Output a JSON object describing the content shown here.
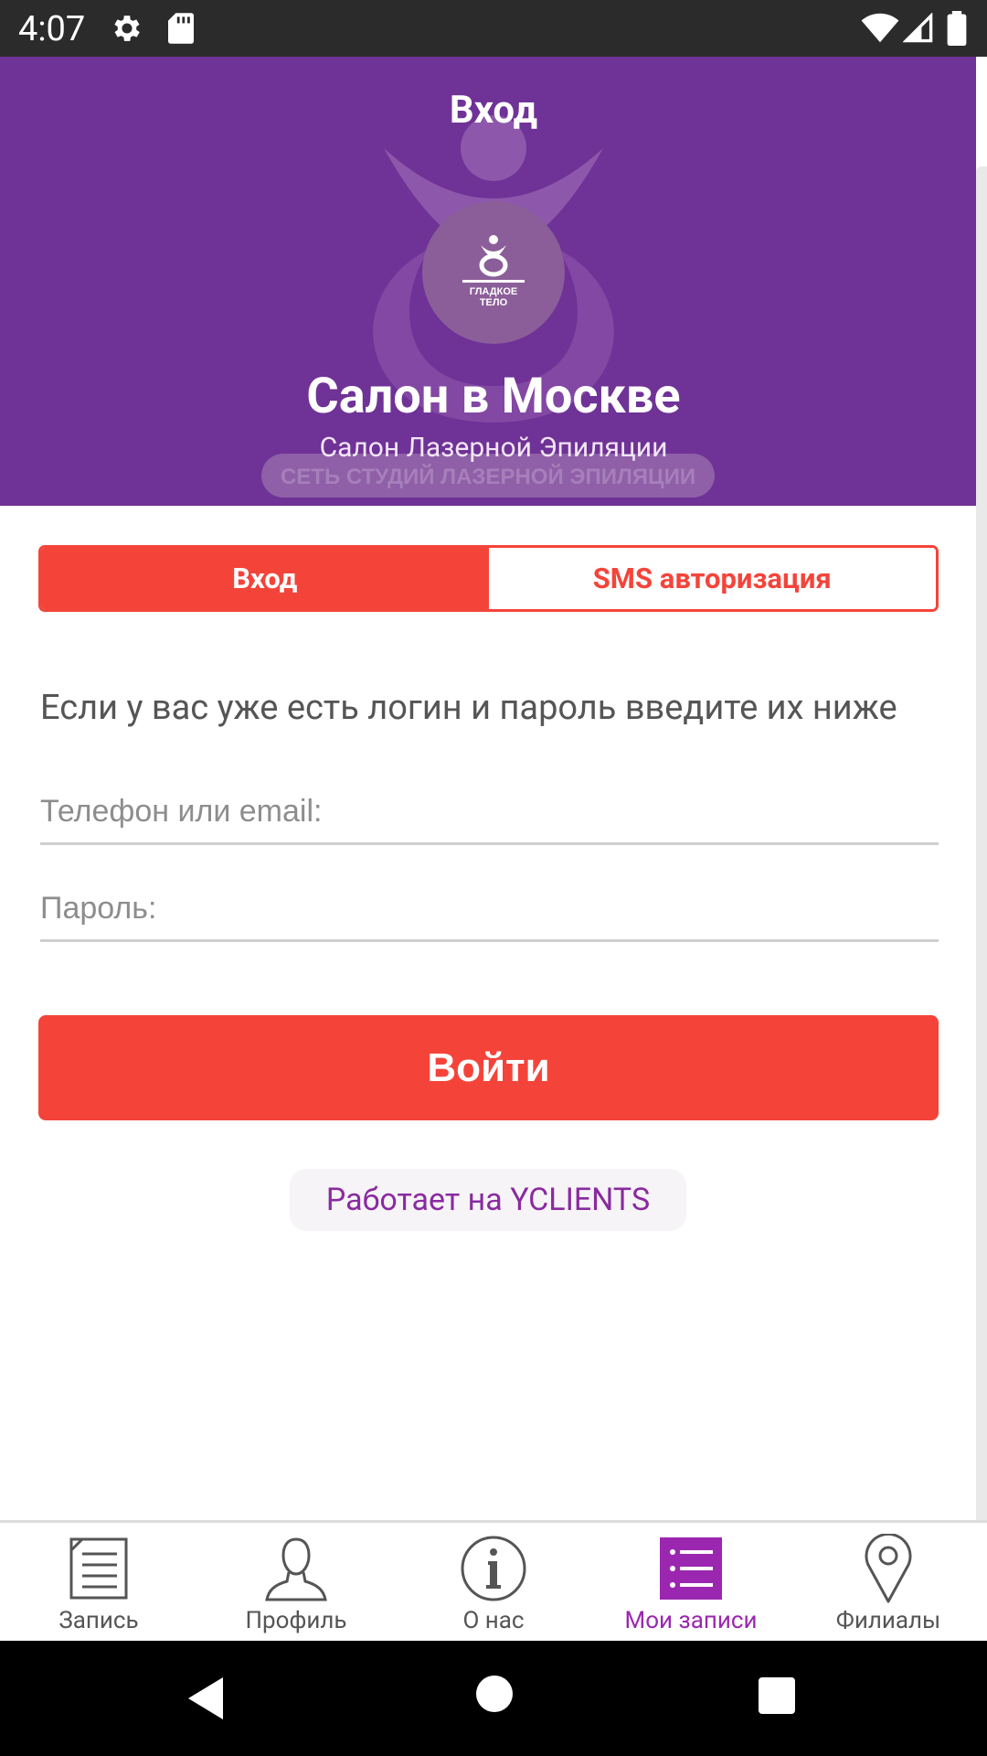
{
  "status_bar": {
    "time": "4:07"
  },
  "header": {
    "title": "Вход",
    "salon_name": "Салон в Москве",
    "salon_subtitle": "Салон Лазерной Эпиляции",
    "logo_text": "ГЛАДКОЕ ТЕЛО",
    "background_watermark": "СЕТЬ СТУДИЙ ЛАЗЕРНОЙ ЭПИЛЯЦИИ",
    "bg_color": "#6f3296"
  },
  "tabs": {
    "login_label": "Вход",
    "sms_label": "SMS авторизация",
    "active": "login"
  },
  "form": {
    "instruction": "Если у вас уже есть логин и пароль введите их ниже",
    "login_placeholder": "Телефон или email:",
    "login_value": "",
    "password_placeholder": "Пароль:",
    "password_value": "",
    "submit_label": "Войти",
    "accent_color": "#f4443a"
  },
  "powered_by": "Работает на YCLIENTS",
  "bottom_nav": {
    "items": [
      {
        "label": "Запись",
        "icon": "document-icon"
      },
      {
        "label": "Профиль",
        "icon": "person-icon"
      },
      {
        "label": "О нас",
        "icon": "info-icon"
      },
      {
        "label": "Мои записи",
        "icon": "list-icon",
        "active": true
      },
      {
        "label": "Филиалы",
        "icon": "location-pin-icon"
      }
    ],
    "active_color": "#9b27b0"
  }
}
